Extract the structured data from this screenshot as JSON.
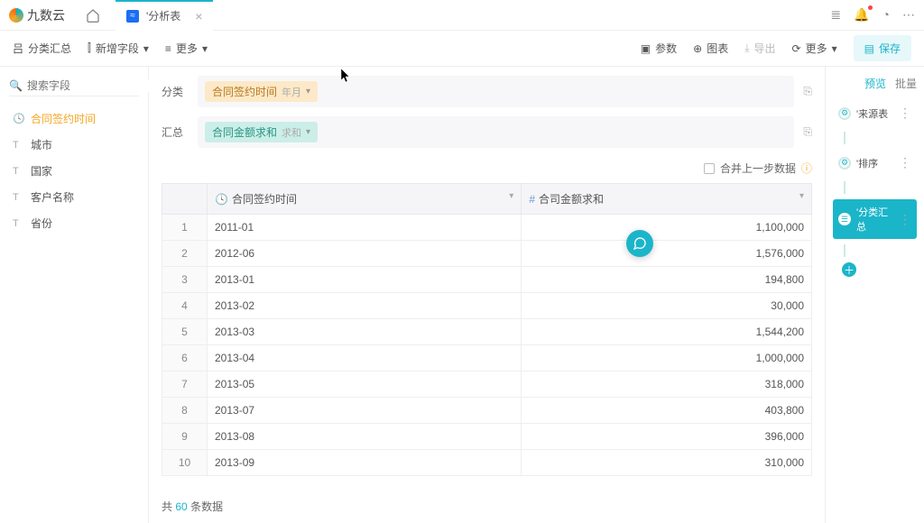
{
  "header": {
    "logo_text": "九数云",
    "tab_title": "'分析表"
  },
  "toolbar": {
    "group_label": "分类汇总",
    "add_field_label": "新增字段",
    "more_label": "更多",
    "params_label": "参数",
    "chart_label": "图表",
    "export_label": "导出",
    "more2_label": "更多",
    "save_label": "保存"
  },
  "left": {
    "search_placeholder": "搜索字段",
    "fields": [
      {
        "type": "time",
        "label": "合同签约时间",
        "active": true
      },
      {
        "type": "text",
        "label": "城市",
        "active": false
      },
      {
        "type": "text",
        "label": "国家",
        "active": false
      },
      {
        "type": "text",
        "label": "客户名称",
        "active": false
      },
      {
        "type": "text",
        "label": "省份",
        "active": false
      }
    ]
  },
  "config": {
    "row1_label": "分类",
    "row2_label": "汇总",
    "pill1_main": "合同签约时间",
    "pill1_sub": "年月",
    "pill2_main": "合同金额求和",
    "pill2_sub": "求和",
    "merge_label": "合并上一步数据"
  },
  "table": {
    "col1": "合同签约时间",
    "col2": "合司金额求和",
    "rows": [
      {
        "n": "1",
        "date": "2011-01",
        "val": "1,100,000"
      },
      {
        "n": "2",
        "date": "2012-06",
        "val": "1,576,000"
      },
      {
        "n": "3",
        "date": "2013-01",
        "val": "194,800"
      },
      {
        "n": "4",
        "date": "2013-02",
        "val": "30,000"
      },
      {
        "n": "5",
        "date": "2013-03",
        "val": "1,544,200"
      },
      {
        "n": "6",
        "date": "2013-04",
        "val": "1,000,000"
      },
      {
        "n": "7",
        "date": "2013-05",
        "val": "318,000"
      },
      {
        "n": "8",
        "date": "2013-07",
        "val": "403,800"
      },
      {
        "n": "9",
        "date": "2013-08",
        "val": "396,000"
      },
      {
        "n": "10",
        "date": "2013-09",
        "val": "310,000"
      }
    ]
  },
  "footer": {
    "prefix": "共",
    "count": "60",
    "suffix": "条数据"
  },
  "right": {
    "tab1": "预览",
    "tab2": "批量",
    "steps": [
      {
        "label": "'来源表",
        "active": false
      },
      {
        "label": "'排序",
        "active": false
      },
      {
        "label": "'分类汇总",
        "active": true
      }
    ]
  },
  "chart_data": {
    "type": "table",
    "title": "分类汇总",
    "columns": [
      "合同签约时间",
      "合司金额求和"
    ],
    "rows": [
      [
        "2011-01",
        1100000
      ],
      [
        "2012-06",
        1576000
      ],
      [
        "2013-01",
        194800
      ],
      [
        "2013-02",
        30000
      ],
      [
        "2013-03",
        1544200
      ],
      [
        "2013-04",
        1000000
      ],
      [
        "2013-05",
        318000
      ],
      [
        "2013-07",
        403800
      ],
      [
        "2013-08",
        396000
      ],
      [
        "2013-09",
        310000
      ]
    ],
    "total_row_count": 60
  }
}
